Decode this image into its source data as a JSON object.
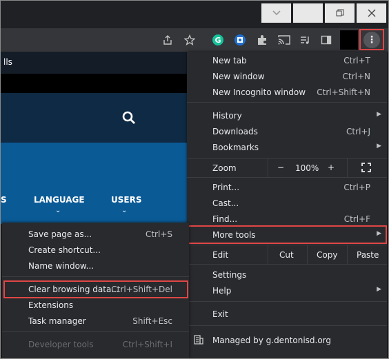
{
  "page": {
    "header_fragment": "lls",
    "nav": [
      {
        "label": "LANGUAGE"
      },
      {
        "label": "USERS"
      }
    ]
  },
  "main_menu": {
    "new_tab": {
      "label": "New tab",
      "shortcut": "Ctrl+T"
    },
    "new_window": {
      "label": "New window",
      "shortcut": "Ctrl+N"
    },
    "new_incognito": {
      "label": "New Incognito window",
      "shortcut": "Ctrl+Shift+N"
    },
    "history": {
      "label": "History"
    },
    "downloads": {
      "label": "Downloads",
      "shortcut": "Ctrl+J"
    },
    "bookmarks": {
      "label": "Bookmarks"
    },
    "zoom": {
      "label": "Zoom",
      "minus": "−",
      "value": "100%",
      "plus": "+"
    },
    "print": {
      "label": "Print...",
      "shortcut": "Ctrl+P"
    },
    "cast": {
      "label": "Cast..."
    },
    "find": {
      "label": "Find...",
      "shortcut": "Ctrl+F"
    },
    "more_tools": {
      "label": "More tools"
    },
    "edit": {
      "label": "Edit",
      "cut": "Cut",
      "copy": "Copy",
      "paste": "Paste"
    },
    "settings": {
      "label": "Settings"
    },
    "help": {
      "label": "Help"
    },
    "exit": {
      "label": "Exit"
    },
    "managed": {
      "label": "Managed by g.dentonisd.org"
    }
  },
  "submenu": {
    "save_page": {
      "label": "Save page as...",
      "shortcut": "Ctrl+S"
    },
    "create_shortcut": {
      "label": "Create shortcut..."
    },
    "name_window": {
      "label": "Name window..."
    },
    "clear_browsing": {
      "label": "Clear browsing data...",
      "shortcut": "Ctrl+Shift+Del"
    },
    "extensions": {
      "label": "Extensions"
    },
    "task_manager": {
      "label": "Task manager",
      "shortcut": "Shift+Esc"
    },
    "developer_tools": {
      "label": "Developer tools",
      "shortcut": "Ctrl+Shift+I"
    }
  },
  "colors": {
    "highlight": "#e04646",
    "menu_bg": "#292a2d",
    "site_blue": "#0a5a96",
    "grammarly": "#15c39a"
  },
  "icons": [
    "chevron-down-icon",
    "restore-icon",
    "close-icon",
    "share-icon",
    "star-icon",
    "grammarly-icon",
    "extension-badge-icon",
    "puzzle-icon",
    "cast-icon",
    "media-icon",
    "sidebar-icon",
    "kebab-icon",
    "search-icon",
    "building-icon",
    "submenu-arrow-icon"
  ]
}
